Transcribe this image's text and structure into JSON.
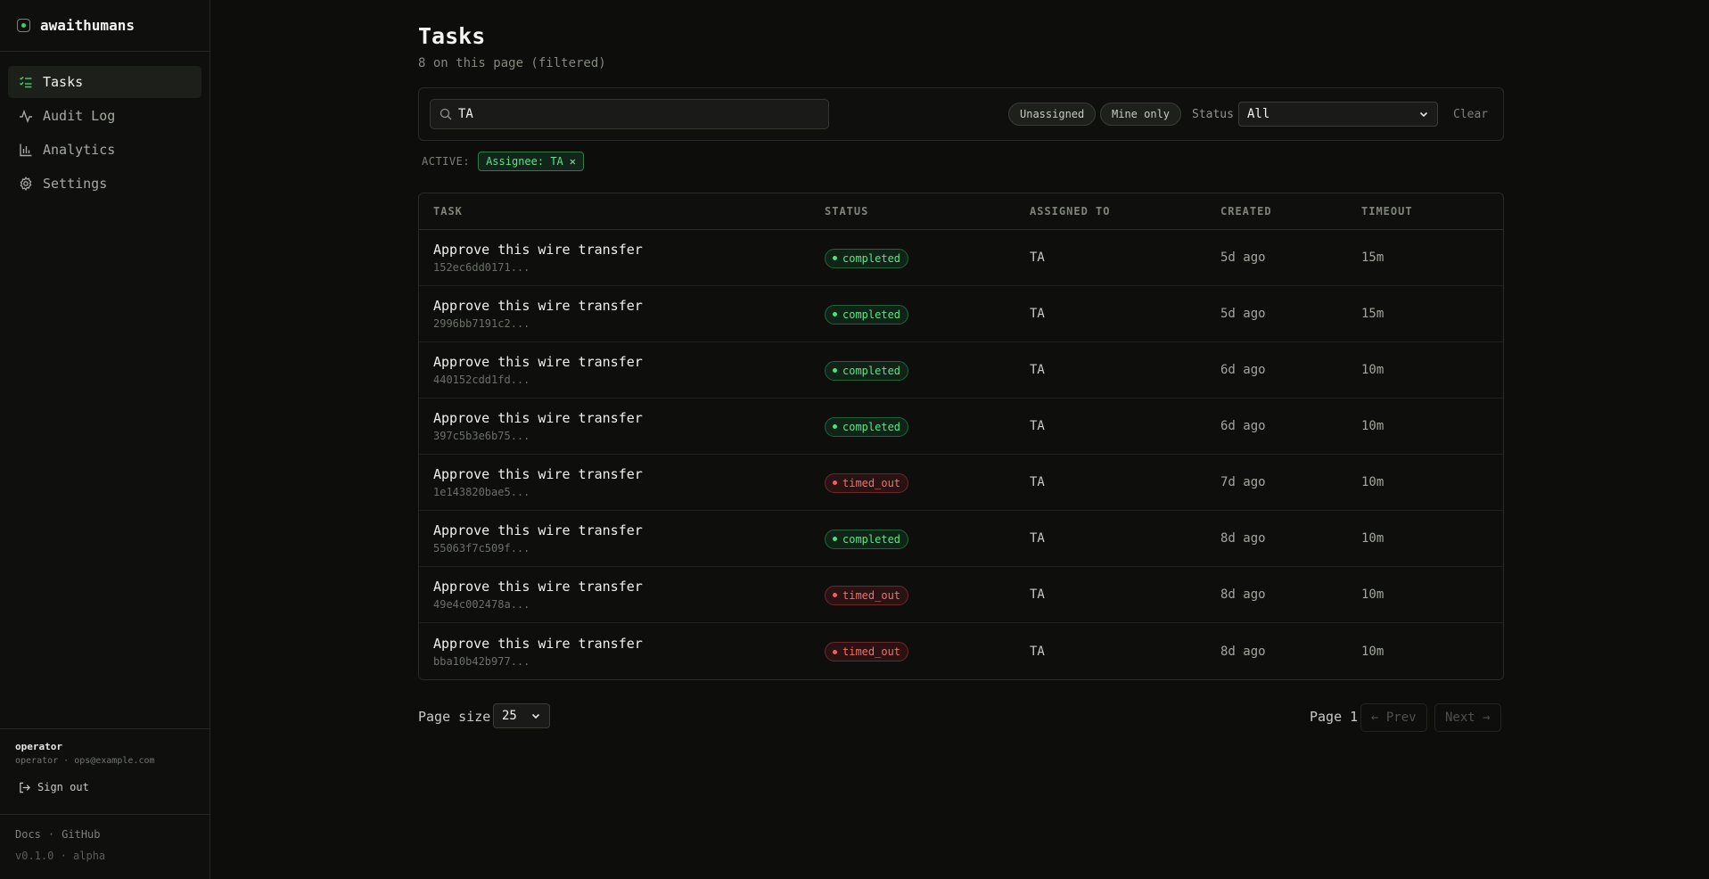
{
  "brand": {
    "name": "awaithumans",
    "accent": "#3ecf6c"
  },
  "nav": [
    {
      "label": "Tasks",
      "icon": "list-check-icon",
      "active": true
    },
    {
      "label": "Audit Log",
      "icon": "activity-icon",
      "active": false
    },
    {
      "label": "Analytics",
      "icon": "bar-chart-icon",
      "active": false
    },
    {
      "label": "Settings",
      "icon": "gear-icon",
      "active": false
    }
  ],
  "user": {
    "name": "operator",
    "meta": "operator · ops@example.com",
    "signout_label": "Sign out"
  },
  "footer": {
    "docs": "Docs",
    "separator": "·",
    "github": "GitHub",
    "version": "v0.1.0 · alpha"
  },
  "page": {
    "title": "Tasks",
    "subtitle": "8 on this page (filtered)"
  },
  "filters": {
    "search_value": "TA",
    "unassigned_label": "Unassigned",
    "mine_only_label": "Mine only",
    "status_label": "Status",
    "status_value": "All",
    "clear_label": "Clear",
    "active_label": "ACTIVE:",
    "active_tag": "Assignee: TA",
    "active_tag_remove": "✕"
  },
  "table": {
    "headers": {
      "task": "TASK",
      "status": "STATUS",
      "assigned": "ASSIGNED TO",
      "created": "CREATED",
      "timeout": "TIMEOUT"
    },
    "rows": [
      {
        "title": "Approve this wire transfer",
        "id": "152ec6dd0171...",
        "status": "completed",
        "assigned": "TA",
        "created": "5d ago",
        "timeout": "15m"
      },
      {
        "title": "Approve this wire transfer",
        "id": "2996bb7191c2...",
        "status": "completed",
        "assigned": "TA",
        "created": "5d ago",
        "timeout": "15m"
      },
      {
        "title": "Approve this wire transfer",
        "id": "440152cdd1fd...",
        "status": "completed",
        "assigned": "TA",
        "created": "6d ago",
        "timeout": "10m"
      },
      {
        "title": "Approve this wire transfer",
        "id": "397c5b3e6b75...",
        "status": "completed",
        "assigned": "TA",
        "created": "6d ago",
        "timeout": "10m"
      },
      {
        "title": "Approve this wire transfer",
        "id": "1e143820bae5...",
        "status": "timed_out",
        "assigned": "TA",
        "created": "7d ago",
        "timeout": "10m"
      },
      {
        "title": "Approve this wire transfer",
        "id": "55063f7c509f...",
        "status": "completed",
        "assigned": "TA",
        "created": "8d ago",
        "timeout": "10m"
      },
      {
        "title": "Approve this wire transfer",
        "id": "49e4c002478a...",
        "status": "timed_out",
        "assigned": "TA",
        "created": "8d ago",
        "timeout": "10m"
      },
      {
        "title": "Approve this wire transfer",
        "id": "bba10b42b977...",
        "status": "timed_out",
        "assigned": "TA",
        "created": "8d ago",
        "timeout": "10m"
      }
    ]
  },
  "pagination": {
    "page_size_label": "Page size",
    "page_size_value": "25",
    "page_label": "Page 1",
    "prev_label": "← Prev",
    "next_label": "Next →"
  }
}
